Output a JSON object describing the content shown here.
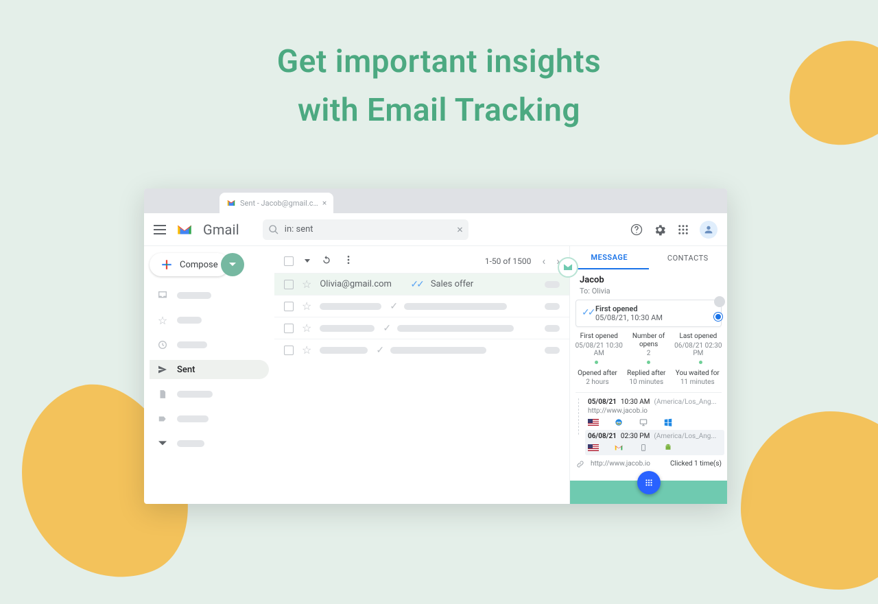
{
  "hero": {
    "line1": "Get important insights",
    "line2": "with Email Tracking"
  },
  "browser": {
    "tab_title": "Sent - Jacob@gmail.c…"
  },
  "app": {
    "brand": "Gmail",
    "search_value": "in: sent",
    "compose_label": "Compose"
  },
  "sidebar": {
    "active_label": "Sent"
  },
  "toolbar": {
    "count_label": "1-50 of 1500"
  },
  "rows": {
    "r0": {
      "sender": "Olivia@gmail.com",
      "subject": "Sales offer"
    }
  },
  "panel": {
    "tabs": {
      "message": "MESSAGE",
      "contacts": "CONTACTS"
    },
    "name": "Jacob",
    "to": "To: Olivia",
    "first_open": {
      "title": "First opened",
      "date": "05/08/21, 10:30 AM"
    },
    "stat_first_label": "First opened",
    "stat_first_val": "05/08/21 10:30 AM",
    "stat_num_label": "Number of opens",
    "stat_num_val": "2",
    "stat_last_label": "Last opened",
    "stat_last_val": "06/08/21 02:30 PM",
    "stat_after_label": "Opened after",
    "stat_after_val": "2 hours",
    "stat_replied_label": "Replied after",
    "stat_replied_val": "10 minutes",
    "stat_wait_label": "You waited for",
    "stat_wait_val": "11 minutes",
    "ev1": {
      "date": "05/08/21",
      "time": "10:30 AM",
      "tz": "(America/Los_Ang...",
      "url": "http://www.jacob.io"
    },
    "ev2": {
      "date": "06/08/21",
      "time": "02:30 PM",
      "tz": "(America/Los_Ang..."
    },
    "link": {
      "url": "http://www.jacob.io",
      "clicks": "Clicked 1 time(s)"
    }
  }
}
